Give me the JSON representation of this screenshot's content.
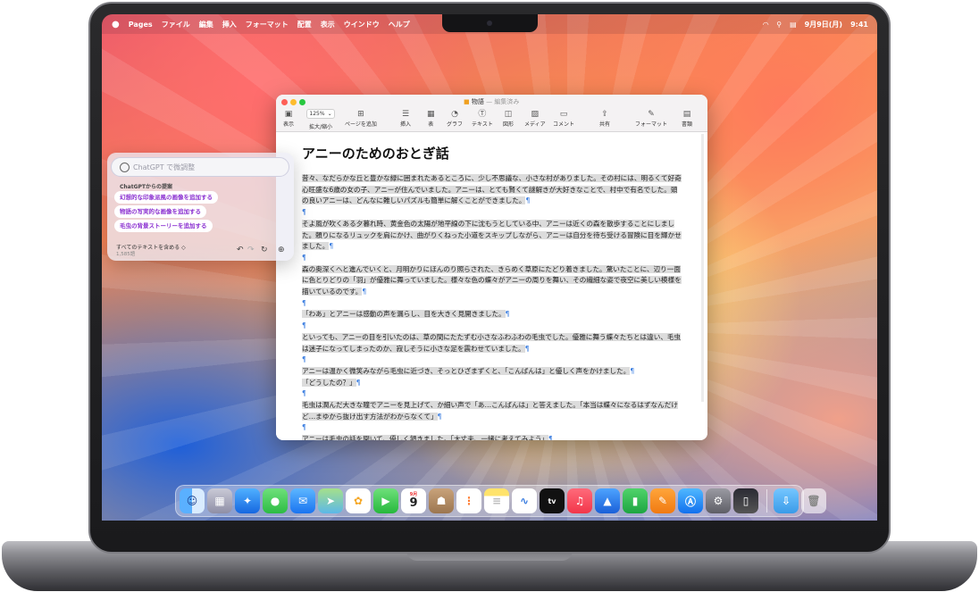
{
  "menubar": {
    "apple": "",
    "app_name": "Pages",
    "items": [
      "ファイル",
      "編集",
      "挿入",
      "フォーマット",
      "配置",
      "表示",
      "ウインドウ",
      "ヘルプ"
    ],
    "date": "9月9日(月)",
    "time": "9:41"
  },
  "window": {
    "title": "物語",
    "title_status": "— 編集済み",
    "zoom_value": "125%",
    "toolbar": {
      "view": "表示",
      "zoom": "拡大/縮小",
      "add_page": "ページを追加",
      "insert": "挿入",
      "table": "表",
      "chart": "グラフ",
      "text": "テキスト",
      "shape": "図形",
      "media": "メディア",
      "comment": "コメント",
      "share": "共有",
      "format": "フォーマット",
      "document": "書類"
    }
  },
  "document": {
    "title": "アニーのためのおとぎ話",
    "paragraphs": [
      "昔々、なだらかな丘と豊かな緑に囲まれたあるところに、少し不思議な、小さな村がありました。その村には、明るくて好奇心旺盛な6歳の女の子、アニーが住んでいました。アニーは、とても賢くて謎解きが大好きなことで、村中で有名でした。頭の良いアニーは、どんなに難しいパズルも簡単に解くことができました。",
      "",
      "そよ風が吹くある夕暮れ時、黄金色の太陽が地平線の下に沈もうとしている中、アニーは近くの森を散歩することにしました。頼りになるリュックを肩にかけ、曲がりくねった小道をスキップしながら、アニーは自分を待ち受ける冒険に目を輝かせました。",
      "",
      "森の奥深くへと進んでいくと、月明かりにほんのり照らされた、きらめく草原にたどり着きました。驚いたことに、辺り一面に色とりどりの「羽」が優雅に舞っていました。様々な色の蝶々がアニーの周りを舞い、その繊細な姿で夜空に美しい模様を描いているのです。",
      "",
      "「わあ」とアニーは感動の声を漏らし、目を大きく見開きました。",
      "",
      "といっても、アニーの目を引いたのは、草の間にたたずむ小さなふわふわの毛虫でした。優雅に舞う蝶々たちとは違い、毛虫は迷子になってしまったのか、寂しそうに小さな足を震わせていました。",
      "",
      "アニーは温かく微笑みながら毛虫に近づき、そっとひざまずくと、「こんばんは」と優しく声をかけました。",
      "「どうしたの？」",
      "",
      "毛虫は潤んだ大きな瞳でアニーを見上げて、か細い声で「あ…こんばんは」と答えました。「本当は蝶々になるはずなんだけど…まゆから抜け出す方法がわからなくて」",
      "",
      "アニーは毛虫の話を聞いて、優しく頷きました。「大丈夫、一緒に考えてみよう」"
    ]
  },
  "chatgpt": {
    "placeholder": "ChatGPT で微調整",
    "suggestions_header": "ChatGPTからの提案",
    "suggestions": [
      "幻想的な印象派風の画像を追加する",
      "物語の写実的な画像を追加する",
      "毛虫の背景ストーリーを追加する"
    ],
    "scope_label": "すべてのテキストを含める ◇",
    "word_count": "1,585語"
  },
  "dock": {
    "calendar_month": "9月",
    "calendar_day": "9",
    "apps": [
      "finder-icon",
      "launchpad-icon",
      "safari-icon",
      "messages-icon",
      "mail-icon",
      "maps-icon",
      "photos-icon",
      "facetime-icon",
      "calendar-icon",
      "contacts-icon",
      "reminders-icon",
      "notes-icon",
      "freeform-icon",
      "tv-icon",
      "music-icon",
      "keynote-icon",
      "numbers-icon",
      "pages-icon",
      "app-store-icon",
      "system-settings-icon",
      "iphone-mirroring-icon",
      "downloads-folder-icon",
      "trash-icon"
    ],
    "tv_label": "tv"
  },
  "colors": {
    "accent": "#3a7de0",
    "suggestion_text": "#8a2fd0"
  }
}
